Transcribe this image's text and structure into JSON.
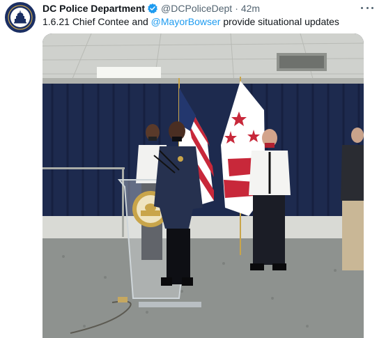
{
  "tweet": {
    "display_name": "DC Police Department",
    "handle": "@DCPoliceDept",
    "separator": "·",
    "time": "42m",
    "text_before": "1.6.21 Chief Contee and ",
    "mention": "@MayorBowser",
    "text_after": " provide situational updates"
  },
  "colors": {
    "accent": "#1d9bf0",
    "name_text": "#0f1419",
    "secondary_text": "#536471",
    "avatar_bg": "#1b2f63"
  },
  "icons": {
    "verified": "verified-badge-icon",
    "more": "more-options-icon"
  }
}
